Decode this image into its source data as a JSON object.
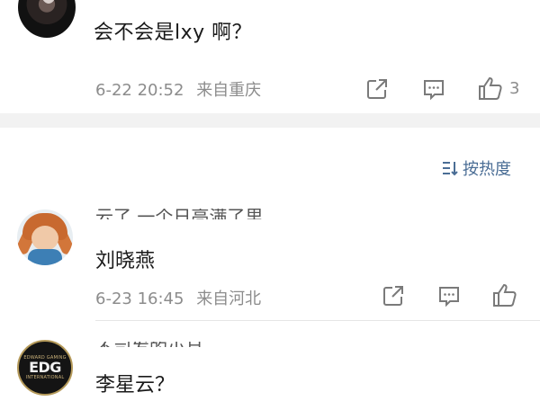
{
  "comments": [
    {
      "avatar": "user-photo-dark",
      "text": "会不会是lxy 啊？",
      "time": "6-22 20:52",
      "location": "来自重庆",
      "likes": "3"
    },
    {
      "avatar": "cartoon-girl-red-braids",
      "username": "云了 一个日亮满了里",
      "text": "刘晓燕",
      "time": "6-23 16:45",
      "location": "来自河北",
      "likes": ""
    },
    {
      "avatar": "edg-logo",
      "avatar_text": "EDG",
      "avatar_subtext_top": "EDWARD GAMING",
      "avatar_subtext_bottom": "INTERNATIONAL",
      "username": "不司发的小月",
      "text": "李星云？"
    }
  ],
  "sort": {
    "label": "按热度",
    "icon": "sort-icon"
  },
  "colors": {
    "accent": "#4a6d95",
    "meta": "#8c8c8c",
    "band": "#f2f2f2"
  }
}
